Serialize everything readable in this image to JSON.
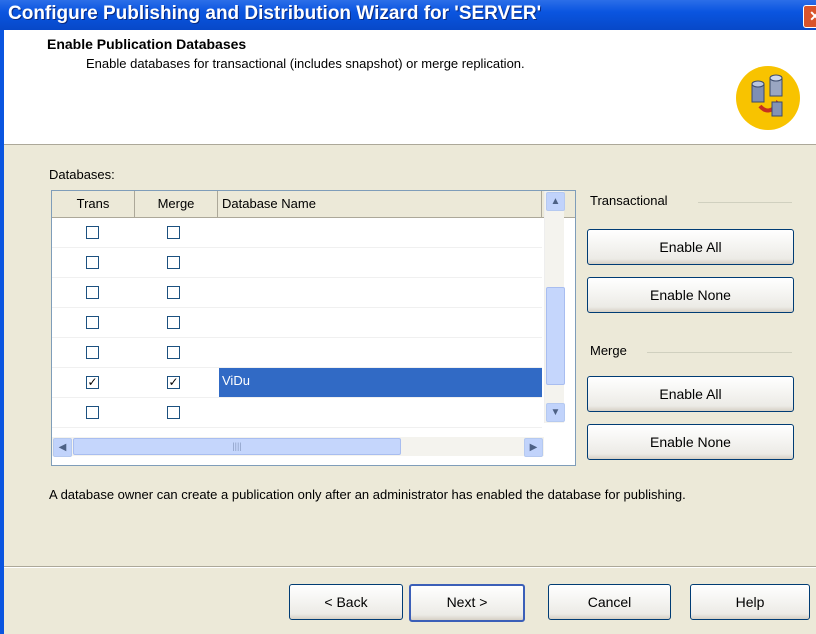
{
  "window": {
    "title": "Configure Publishing and Distribution Wizard for 'SERVER'",
    "close_glyph": "✕"
  },
  "header": {
    "title": "Enable Publication Databases",
    "subtitle": "Enable databases for transactional (includes snapshot) or merge replication.",
    "icon": "replication-wizard-icon"
  },
  "databases": {
    "label": "Databases:",
    "columns": [
      "Trans",
      "Merge",
      "Database Name"
    ],
    "rows": [
      {
        "trans": false,
        "merge": false,
        "name": ""
      },
      {
        "trans": false,
        "merge": false,
        "name": ""
      },
      {
        "trans": false,
        "merge": false,
        "name": ""
      },
      {
        "trans": false,
        "merge": false,
        "name": ""
      },
      {
        "trans": false,
        "merge": false,
        "name": ""
      },
      {
        "trans": true,
        "merge": true,
        "name": "ViDu",
        "selected": true
      },
      {
        "trans": false,
        "merge": false,
        "name": ""
      }
    ],
    "scroll_glyphs": {
      "up": "▲",
      "down": "▼",
      "left": "◀",
      "right": "▶",
      "grip": "||||"
    }
  },
  "transactional": {
    "label": "Transactional",
    "enable_all": "Enable All",
    "enable_none": "Enable None"
  },
  "merge": {
    "label": "Merge",
    "enable_all": "Enable All",
    "enable_none": "Enable None"
  },
  "info_text": "A database owner can create a publication only after an administrator has enabled the database for publishing.",
  "footer": {
    "back": "< Back",
    "next": "Next >",
    "cancel": "Cancel",
    "help": "Help"
  },
  "colors": {
    "titlebar": "#0a55e0",
    "selection": "#316ac5",
    "dialog_bg": "#ece9d8"
  }
}
